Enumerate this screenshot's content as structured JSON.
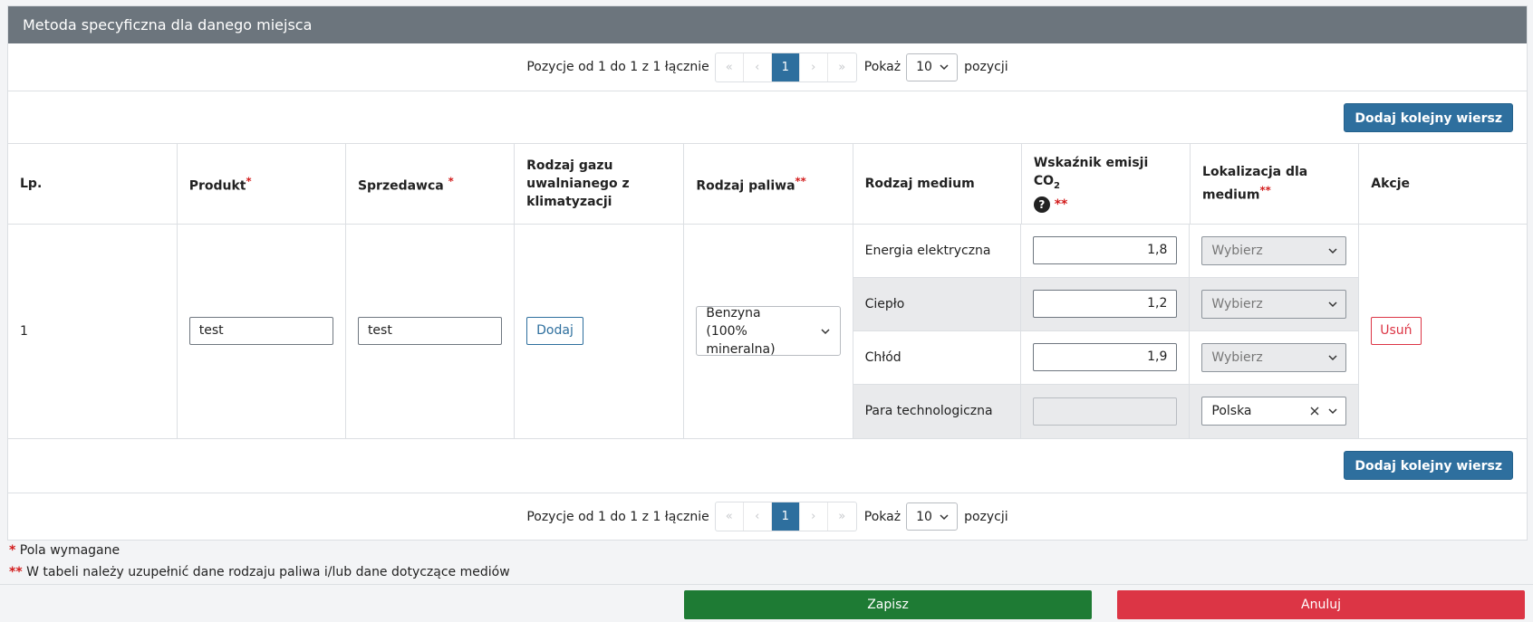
{
  "panel": {
    "title": "Metoda specyficzna dla danego miejsca"
  },
  "pager": {
    "info": "Pozycje od 1 do 1 z 1 łącznie",
    "first": "«",
    "prev": "‹",
    "current": "1",
    "next": "›",
    "last": "»",
    "show_label": "Pokaż",
    "page_size": "10",
    "suffix": "pozycji"
  },
  "buttons": {
    "add_row": "Dodaj kolejny wiersz",
    "add": "Dodaj",
    "remove": "Usuń",
    "save": "Zapisz",
    "cancel": "Anuluj"
  },
  "table": {
    "headers": {
      "lp": "Lp.",
      "produkt": "Produkt",
      "sprzedawca": "Sprzedawca",
      "gaz": "Rodzaj gazu uwalnianego z klimatyzacji",
      "paliwo": "Rodzaj paliwa",
      "medium": "Rodzaj medium",
      "wskaznik": "Wskaźnik emisji CO",
      "wskaznik_sub": "2",
      "lokalizacja": "Lokalizacja dla medium",
      "akcje": "Akcje"
    },
    "required_marks": {
      "single": "*",
      "double": "**"
    },
    "help_icon": "?",
    "row": {
      "lp": "1",
      "produkt": "test",
      "sprzedawca": "test",
      "paliwo": "Benzyna (100% mineralna)",
      "media": [
        {
          "name": "Energia elektryczna",
          "factor": "1,8",
          "location": "Wybierz"
        },
        {
          "name": "Ciepło",
          "factor": "1,2",
          "location": "Wybierz"
        },
        {
          "name": "Chłód",
          "factor": "1,9",
          "location": "Wybierz"
        },
        {
          "name": "Para technologiczna",
          "factor": "",
          "location": "Polska"
        }
      ]
    }
  },
  "legend": {
    "single_text": "Pola wymagane",
    "double_text": "W tabeli należy uzupełnić dane rodzaju paliwa i/lub dane dotyczące mediów"
  }
}
